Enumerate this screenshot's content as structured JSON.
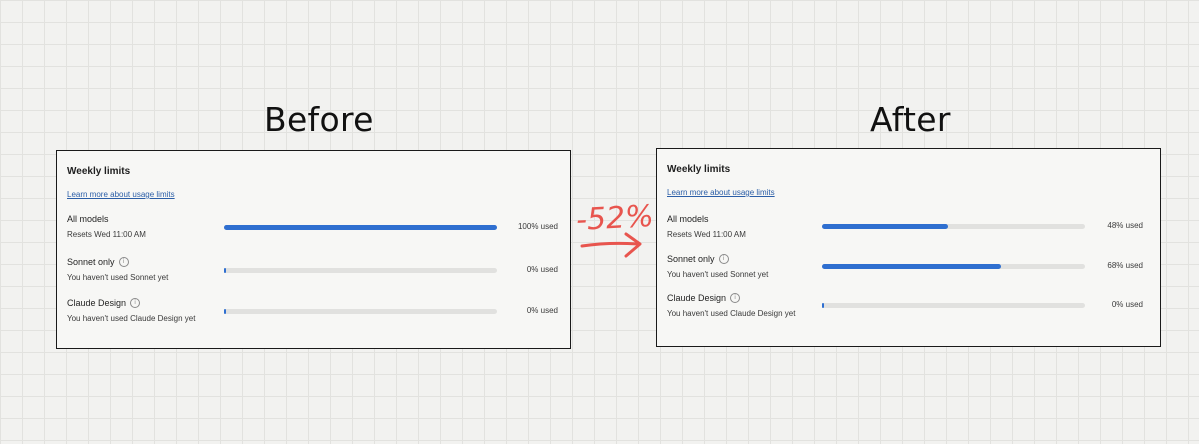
{
  "headings": {
    "before": "Before",
    "after": "After"
  },
  "annotation": {
    "text": "-52%",
    "color": "#e8554e"
  },
  "panels": {
    "before": {
      "title": "Weekly limits",
      "link": "Learn more about usage limits",
      "rows": [
        {
          "name": "All models",
          "info_icon": false,
          "sub": "Resets Wed 11:00 AM",
          "percent": 100,
          "percent_label": "100% used"
        },
        {
          "name": "Sonnet only",
          "info_icon": true,
          "sub": "You haven't used Sonnet yet",
          "percent": 0,
          "percent_label": "0% used"
        },
        {
          "name": "Claude Design",
          "info_icon": true,
          "sub": "You haven't used Claude Design yet",
          "percent": 0,
          "percent_label": "0% used"
        }
      ]
    },
    "after": {
      "title": "Weekly limits",
      "link": "Learn more about usage limits",
      "rows": [
        {
          "name": "All models",
          "info_icon": false,
          "sub": "Resets Wed 11:00 AM",
          "percent": 48,
          "percent_label": "48% used"
        },
        {
          "name": "Sonnet only",
          "info_icon": true,
          "sub": "You haven't used Sonnet yet",
          "percent": 68,
          "percent_label": "68% used"
        },
        {
          "name": "Claude Design",
          "info_icon": true,
          "sub": "You haven't used Claude Design yet",
          "percent": 0,
          "percent_label": "0% used"
        }
      ]
    }
  },
  "colors": {
    "bar_fill": "#2f6fd0",
    "bar_track": "#e1e1df",
    "link": "#2b5ea7"
  },
  "icons": {
    "info": "info-icon"
  }
}
